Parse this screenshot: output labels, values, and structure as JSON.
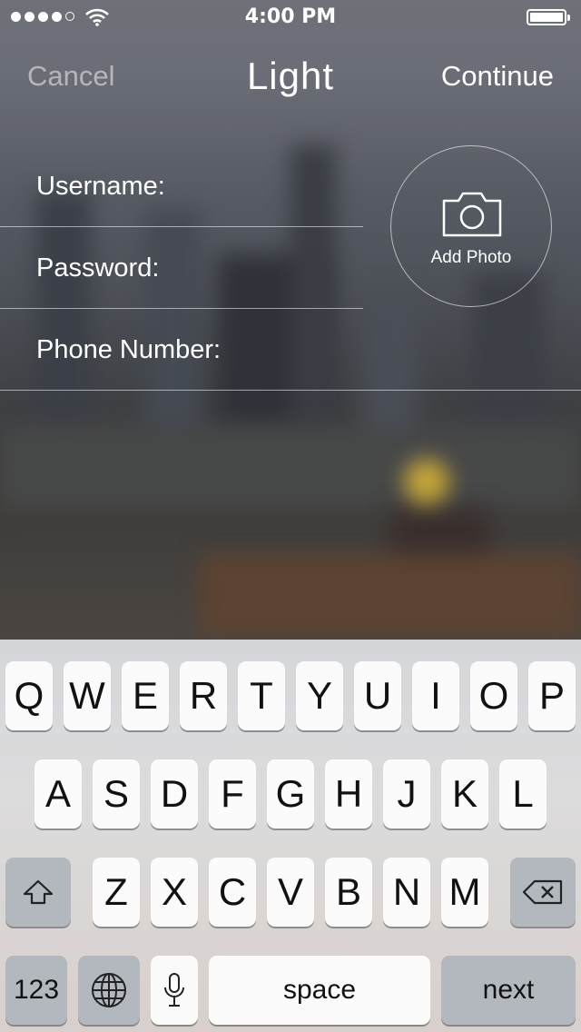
{
  "status_bar": {
    "time": "4:00 PM",
    "signal_bars": 4,
    "signal_total": 5,
    "icons": [
      "wifi-icon",
      "battery-icon"
    ]
  },
  "nav": {
    "cancel": "Cancel",
    "title": "Light",
    "continue": "Continue"
  },
  "form": {
    "username_label": "Username:",
    "password_label": "Password:",
    "phone_label": "Phone Number:"
  },
  "photo": {
    "caption": "Add Photo",
    "icon": "camera-icon"
  },
  "keyboard": {
    "row1": [
      "Q",
      "W",
      "E",
      "R",
      "T",
      "Y",
      "U",
      "I",
      "O",
      "P"
    ],
    "row2": [
      "A",
      "S",
      "D",
      "F",
      "G",
      "H",
      "J",
      "K",
      "L"
    ],
    "row3": [
      "Z",
      "X",
      "C",
      "V",
      "B",
      "N",
      "M"
    ],
    "numbers_key": "123",
    "space_key": "space",
    "return_key": "next",
    "icons": [
      "shift-icon",
      "delete-icon",
      "globe-icon",
      "microphone-icon"
    ]
  }
}
